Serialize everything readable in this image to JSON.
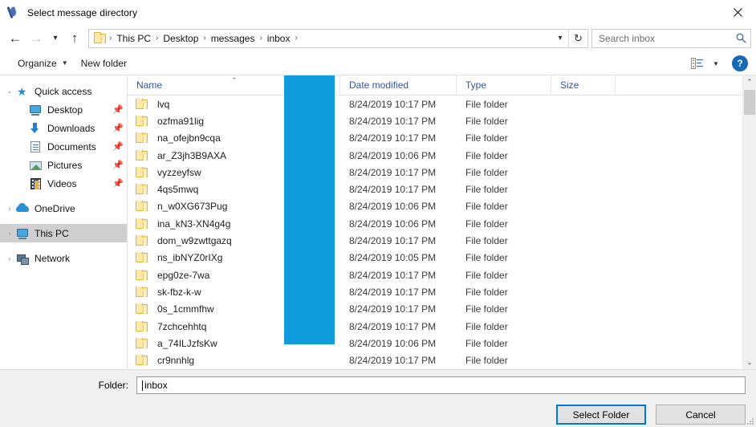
{
  "window": {
    "title": "Select message directory",
    "icon": "quill-icon",
    "close_label": "✕"
  },
  "nav": {
    "back_icon": "arrow-left-icon",
    "forward_icon": "arrow-right-icon",
    "recent_icon": "chevron-down-icon",
    "up_icon": "arrow-up-icon",
    "breadcrumbs": [
      "This PC",
      "Desktop",
      "messages",
      "inbox"
    ],
    "separator": "›",
    "dropdown_icon": "chevron-down-icon",
    "refresh_icon": "refresh-icon"
  },
  "search": {
    "placeholder": "Search inbox",
    "icon": "search-icon"
  },
  "toolbar": {
    "organize_label": "Organize",
    "organize_caret": "▼",
    "new_folder_label": "New folder",
    "view_icon": "view-list-icon",
    "view_caret": "▼",
    "help_label": "?"
  },
  "sidebar": {
    "items": [
      {
        "label": "Quick access",
        "icon": "star-icon",
        "expander": "⌄",
        "expanded": true,
        "indent": 0,
        "pinned": false,
        "selected": false
      },
      {
        "label": "Desktop",
        "icon": "monitor-icon",
        "expander": "",
        "expanded": false,
        "indent": 1,
        "pinned": true,
        "selected": false
      },
      {
        "label": "Downloads",
        "icon": "download-icon",
        "expander": "",
        "expanded": false,
        "indent": 1,
        "pinned": true,
        "selected": false
      },
      {
        "label": "Documents",
        "icon": "document-icon",
        "expander": "",
        "expanded": false,
        "indent": 1,
        "pinned": true,
        "selected": false
      },
      {
        "label": "Pictures",
        "icon": "picture-icon",
        "expander": "",
        "expanded": false,
        "indent": 1,
        "pinned": true,
        "selected": false
      },
      {
        "label": "Videos",
        "icon": "video-icon",
        "expander": "",
        "expanded": false,
        "indent": 1,
        "pinned": true,
        "selected": false
      },
      {
        "label": "OneDrive",
        "icon": "cloud-icon",
        "expander": "›",
        "expanded": false,
        "indent": 0,
        "pinned": false,
        "selected": false
      },
      {
        "label": "This PC",
        "icon": "monitor-icon",
        "expander": "›",
        "expanded": false,
        "indent": 0,
        "pinned": false,
        "selected": true
      },
      {
        "label": "Network",
        "icon": "network-icon",
        "expander": "›",
        "expanded": false,
        "indent": 0,
        "pinned": false,
        "selected": false
      }
    ],
    "pin_glyph": "📌"
  },
  "filelist": {
    "columns": [
      {
        "label": "Name",
        "sorted": true,
        "sort_caret": "⌃"
      },
      {
        "label": "Date modified",
        "sorted": false,
        "sort_caret": ""
      },
      {
        "label": "Type",
        "sorted": false,
        "sort_caret": ""
      },
      {
        "label": "Size",
        "sorted": false,
        "sort_caret": ""
      }
    ],
    "redaction": {
      "color": "#0f9cdd",
      "note": "blue-redaction-box"
    },
    "rows": [
      {
        "name": "lvq",
        "date": "8/24/2019 10:17 PM",
        "type": "File folder",
        "size": ""
      },
      {
        "name": "ozfma91lig",
        "date": "8/24/2019 10:17 PM",
        "type": "File folder",
        "size": ""
      },
      {
        "name": "na_ofejbn9cqa",
        "date": "8/24/2019 10:17 PM",
        "type": "File folder",
        "size": ""
      },
      {
        "name": "ar_Z3jh3B9AXA",
        "date": "8/24/2019 10:06 PM",
        "type": "File folder",
        "size": ""
      },
      {
        "name": "vyzzeyfsw",
        "date": "8/24/2019 10:17 PM",
        "type": "File folder",
        "size": ""
      },
      {
        "name": "4qs5mwq",
        "date": "8/24/2019 10:17 PM",
        "type": "File folder",
        "size": ""
      },
      {
        "name": "n_w0XG673Pug",
        "date": "8/24/2019 10:06 PM",
        "type": "File folder",
        "size": ""
      },
      {
        "name": "ina_kN3-XN4g4g",
        "date": "8/24/2019 10:06 PM",
        "type": "File folder",
        "size": ""
      },
      {
        "name": "dom_w9zwttgazq",
        "date": "8/24/2019 10:17 PM",
        "type": "File folder",
        "size": ""
      },
      {
        "name": "ns_ibNYZ0rIXg",
        "date": "8/24/2019 10:05 PM",
        "type": "File folder",
        "size": ""
      },
      {
        "name": "epg0ze-7wa",
        "date": "8/24/2019 10:17 PM",
        "type": "File folder",
        "size": ""
      },
      {
        "name": "sk-fbz-k-w",
        "date": "8/24/2019 10:17 PM",
        "type": "File folder",
        "size": ""
      },
      {
        "name": "0s_1cmmfhw",
        "date": "8/24/2019 10:17 PM",
        "type": "File folder",
        "size": ""
      },
      {
        "name": "7zchcehhtq",
        "date": "8/24/2019 10:17 PM",
        "type": "File folder",
        "size": ""
      },
      {
        "name": "a_74ILJzfsKw",
        "date": "8/24/2019 10:06 PM",
        "type": "File folder",
        "size": ""
      },
      {
        "name": "cr9nnhlg",
        "date": "8/24/2019 10:17 PM",
        "type": "File folder",
        "size": ""
      }
    ],
    "scrollbar": {
      "up_arrow": "⌃",
      "down_arrow": "⌄"
    }
  },
  "footer": {
    "folder_label": "Folder:",
    "folder_value": "inbox",
    "select_button": "Select Folder",
    "cancel_button": "Cancel"
  }
}
